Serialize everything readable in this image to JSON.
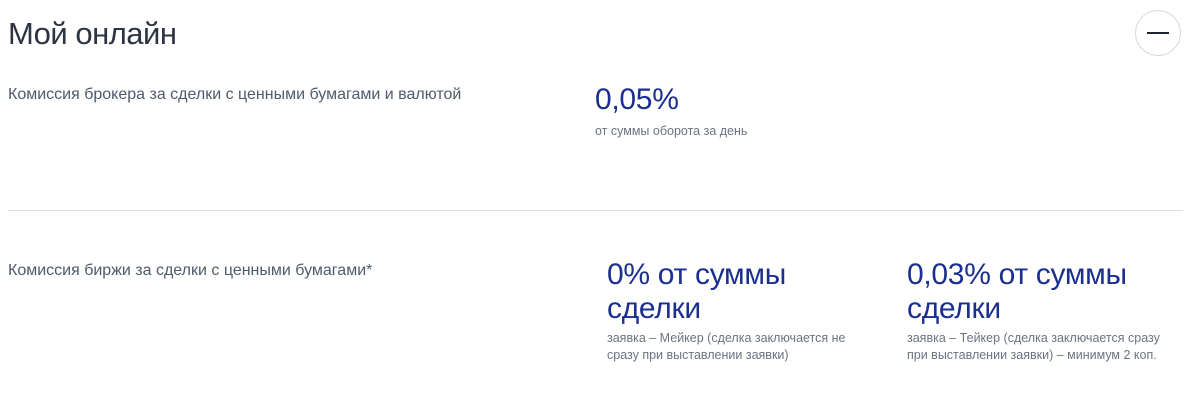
{
  "title": "Мой онлайн",
  "collapse_icon": "minus-icon",
  "broker": {
    "label": "Комиссия брокера за сделки с ценными бумагами и валютой",
    "value": "0,05%",
    "note": "от суммы оборота за день"
  },
  "exchange": {
    "label": "Комиссия биржи за сделки с ценными бумагами*",
    "maker": {
      "value": "0% от суммы сделки",
      "note": "заявка – Мейкер (сделка заключается не сразу при выставлении заявки)"
    },
    "taker": {
      "value": "0,03% от суммы сделки",
      "note": "заявка – Тейкер (сделка заключается сразу при выставлении заявки) – минимум 2 коп."
    }
  },
  "colors": {
    "accent": "#1a2f8f",
    "text": "#4f5a6b",
    "divider": "#dde0e4"
  }
}
